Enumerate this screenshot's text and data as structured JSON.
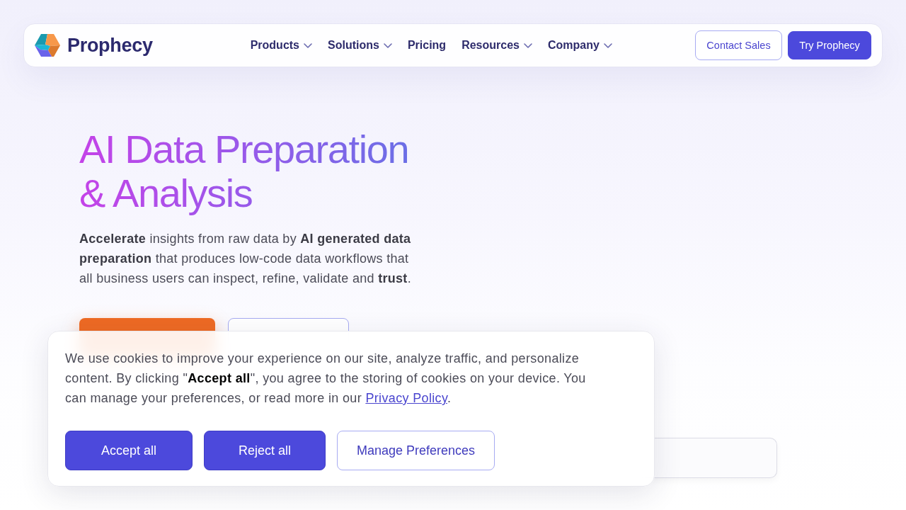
{
  "nav": {
    "brand": "Prophecy",
    "items": [
      {
        "label": "Products",
        "dropdown": true
      },
      {
        "label": "Solutions",
        "dropdown": true
      },
      {
        "label": "Pricing",
        "dropdown": false
      },
      {
        "label": "Resources",
        "dropdown": true
      },
      {
        "label": "Company",
        "dropdown": true
      }
    ],
    "buttons": [
      {
        "label": "Contact Sales",
        "kind": "outline"
      },
      {
        "label": "Try Prophecy",
        "kind": "primary"
      }
    ]
  },
  "hero": {
    "title": "AI Data Preparation & Analysis",
    "text": "**Accelerate** insights from raw data by **AI generated data preparation** that produces low-code data workflows that all business users can inspect, refine, validate and **trust**.",
    "buttons": [
      {
        "kind": "primary"
      },
      {
        "kind": "outline"
      }
    ]
  },
  "cookie_banner": {
    "text": "We use cookies to improve your experience on our site, analyze traffic, and personalize content. By clicking \"**Accept all**\", you agree to the storing of cookies on your device. You can manage your preferences, or read more in our ",
    "link": "Privacy Policy",
    "text_end": ".",
    "buttons": [
      {
        "label": "Accept all",
        "kind": "primary"
      },
      {
        "label": "Reject all",
        "kind": "primary"
      },
      {
        "label": "Manage Preferences",
        "kind": "outline"
      }
    ]
  }
}
